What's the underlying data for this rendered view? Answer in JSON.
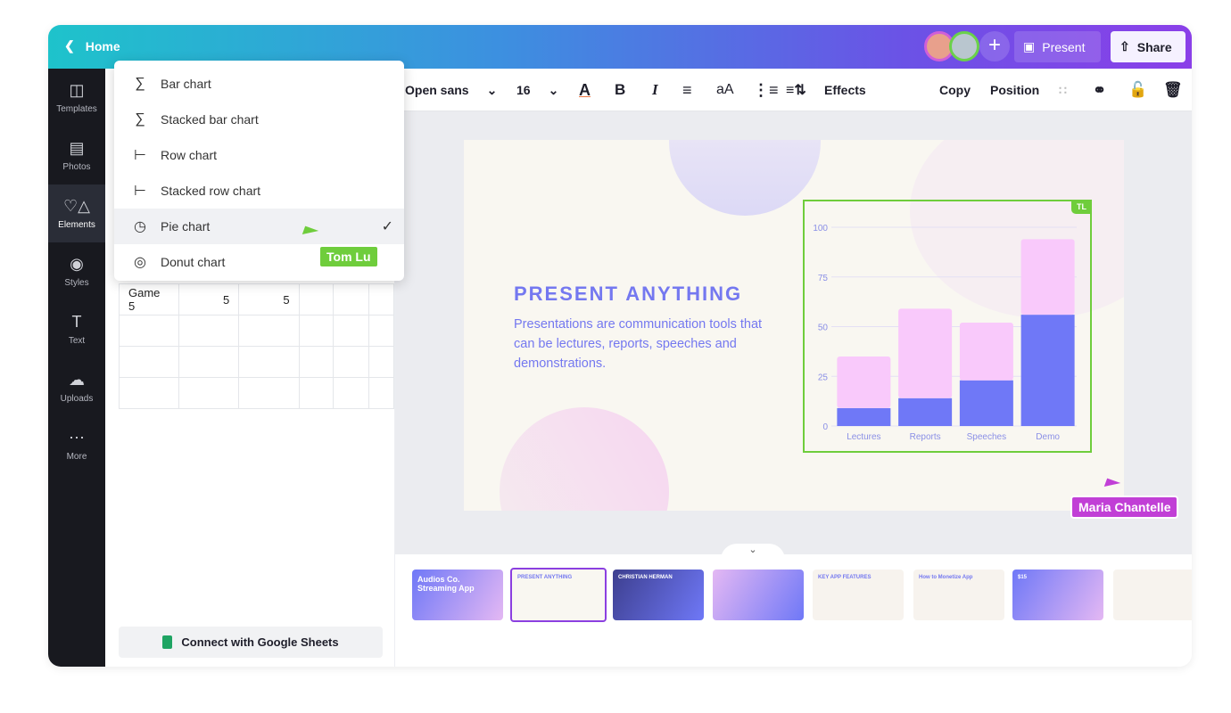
{
  "topbar": {
    "home_label": "Home",
    "present_label": "Present",
    "share_label": "Share",
    "add_collaborator": "+"
  },
  "sidebar": {
    "items": [
      {
        "label": "Templates",
        "icon": "layout-icon"
      },
      {
        "label": "Photos",
        "icon": "image-icon"
      },
      {
        "label": "Elements",
        "icon": "shapes-icon",
        "active": true
      },
      {
        "label": "Styles",
        "icon": "palette-icon"
      },
      {
        "label": "Text",
        "icon": "text-icon"
      },
      {
        "label": "Uploads",
        "icon": "cloud-upload-icon"
      },
      {
        "label": "More",
        "icon": "more-icon"
      }
    ]
  },
  "chart_menu": {
    "items": [
      {
        "label": "Bar chart"
      },
      {
        "label": "Stacked bar chart"
      },
      {
        "label": "Row chart"
      },
      {
        "label": "Stacked row chart"
      },
      {
        "label": "Pie chart",
        "selected": true
      },
      {
        "label": "Donut chart"
      }
    ],
    "check": "✓"
  },
  "data_table": {
    "rows": [
      [
        "Game 5",
        "5",
        "5",
        "",
        "",
        ""
      ],
      [
        "",
        "",
        "",
        "",
        "",
        ""
      ],
      [
        "",
        "",
        "",
        "",
        "",
        ""
      ],
      [
        "",
        "",
        "",
        "",
        "",
        ""
      ]
    ]
  },
  "google_sheets_label": "Connect with Google Sheets",
  "toolbar": {
    "font": "Open sans",
    "font_size": "16",
    "bold": "B",
    "italic": "I",
    "case": "aA",
    "effects": "Effects",
    "copy": "Copy",
    "position": "Position"
  },
  "slide": {
    "title": "PRESENT ANYTHING",
    "subtitle": "Presentations are communication tools that can be lectures, reports, speeches and demonstrations.",
    "chart_badge": "TL"
  },
  "collaborators": [
    {
      "name": "Tom Lu",
      "color": "#6fcd3c"
    },
    {
      "name": "Maria Chantelle",
      "color": "#c13fd6"
    }
  ],
  "chart_data": {
    "type": "bar",
    "stacked": true,
    "categories": [
      "Lectures",
      "Reports",
      "Speeches",
      "Demo"
    ],
    "series": [
      {
        "values": [
          9,
          14,
          23,
          56
        ],
        "color": "#6f78f7"
      },
      {
        "values": [
          26,
          45,
          29,
          38
        ],
        "color": "#f9c9fb"
      }
    ],
    "ylim": [
      0,
      100
    ],
    "yticks": [
      0,
      25,
      50,
      75,
      100
    ],
    "grid": true
  },
  "filmstrip": {
    "thumbs": [
      {
        "text": "Audios Co. Streaming App"
      },
      {
        "text": "PRESENT ANYTHING",
        "selected": true
      },
      {
        "text": "CHRISTIAN HERMAN"
      },
      {
        "text": ""
      },
      {
        "text": "KEY APP FEATURES"
      },
      {
        "text": "How to Monetize App"
      },
      {
        "text": "$15"
      },
      {
        "text": ""
      }
    ]
  }
}
